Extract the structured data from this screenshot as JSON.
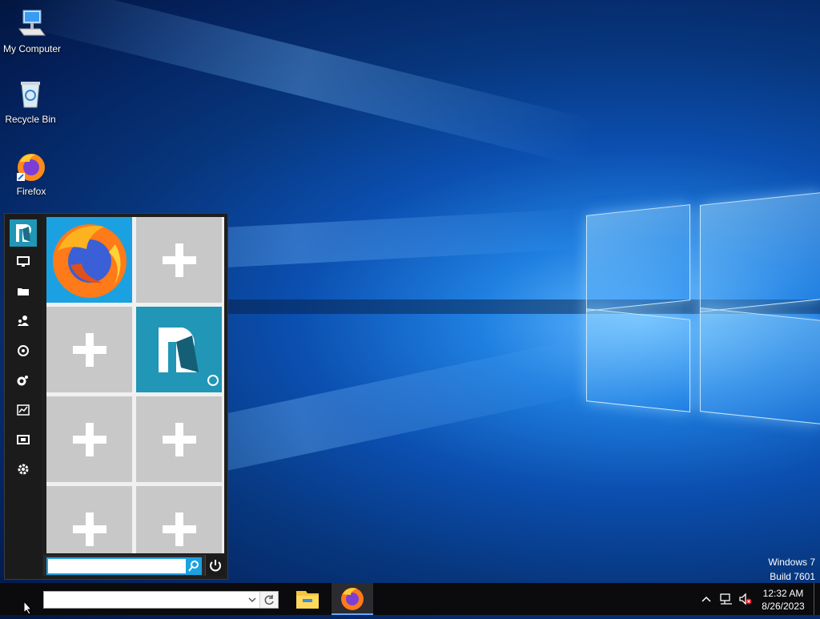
{
  "desktop": {
    "icons": [
      {
        "label": "My Computer",
        "icon": "computer-icon"
      },
      {
        "label": "Recycle Bin",
        "icon": "recycle-bin-icon"
      },
      {
        "label": "Firefox",
        "icon": "firefox-icon"
      }
    ],
    "watermark": {
      "line1": "Windows 7",
      "line2": "Build 7601"
    }
  },
  "start_menu": {
    "sidebar_icons": [
      "app-logo-icon",
      "monitor-icon",
      "folder-icon",
      "users-icon",
      "network-icon",
      "gears-icon",
      "chart-icon",
      "screen-icon",
      "settings-gear-icon"
    ],
    "tiles": [
      {
        "type": "app",
        "icon": "firefox-icon"
      },
      {
        "type": "add",
        "icon": "plus-icon"
      },
      {
        "type": "add",
        "icon": "plus-icon"
      },
      {
        "type": "app",
        "icon": "app-logo-icon"
      },
      {
        "type": "add",
        "icon": "plus-icon"
      },
      {
        "type": "add",
        "icon": "plus-icon"
      },
      {
        "type": "add",
        "icon": "plus-icon"
      },
      {
        "type": "add",
        "icon": "plus-icon"
      }
    ],
    "search": {
      "value": "",
      "placeholder": ""
    },
    "colors": {
      "accent": "#1ba1e2",
      "tile_gray": "#c8c8c8",
      "tile_accent": "#2196b6"
    }
  },
  "taskbar": {
    "address": {
      "value": "",
      "placeholder": ""
    },
    "apps": [
      "file-explorer-icon",
      "firefox-icon"
    ],
    "tray_icons": [
      "chevron-up-icon",
      "network-icon",
      "volume-muted-icon"
    ],
    "clock": {
      "time": "12:32 AM",
      "date": "8/26/2023"
    }
  }
}
